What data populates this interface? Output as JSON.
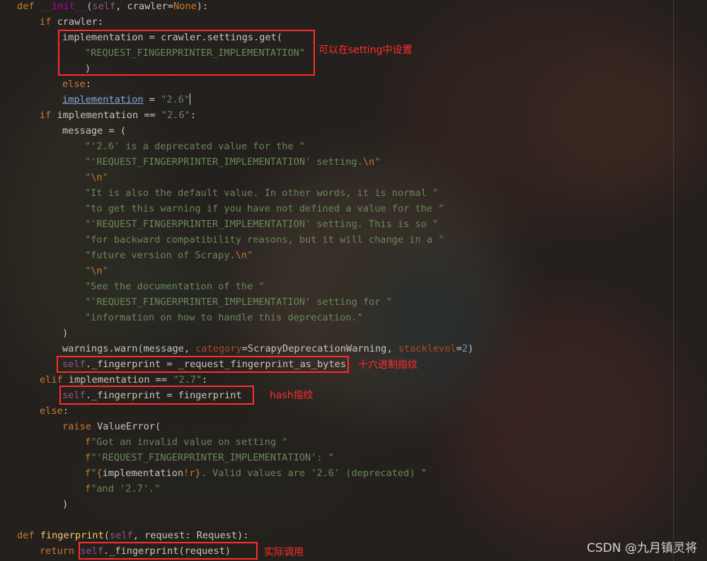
{
  "editor": {
    "lines": [
      [
        [
          "kw",
          "def "
        ],
        [
          "dnd",
          "__init__"
        ],
        [
          "t",
          "("
        ],
        [
          "slf",
          "self"
        ],
        [
          "t",
          ", crawler="
        ],
        [
          "kw",
          "None"
        ],
        [
          "t",
          "):"
        ]
      ],
      [
        [
          "kw",
          "if "
        ],
        [
          "t",
          "crawler:"
        ]
      ],
      [
        [
          "t",
          "implementation = crawler.settings.get("
        ]
      ],
      [
        [
          "str",
          "\"REQUEST_FINGERPRINTER_IMPLEMENTATION\""
        ]
      ],
      [
        [
          "t",
          ")"
        ]
      ],
      [
        [
          "kw",
          "else"
        ],
        [
          "t",
          ":"
        ]
      ],
      [
        [
          "udl",
          "implementation"
        ],
        [
          "t",
          " = "
        ],
        [
          "str",
          "\"2.6\""
        ],
        [
          "cursor",
          ""
        ]
      ],
      [
        [
          "kw",
          "if "
        ],
        [
          "t",
          "implementation == "
        ],
        [
          "str",
          "\"2.6\""
        ],
        [
          "t",
          ":"
        ]
      ],
      [
        [
          "t",
          "message = ("
        ]
      ],
      [
        [
          "str",
          "\"'2.6' is a deprecated value for the \""
        ]
      ],
      [
        [
          "str",
          "\"'REQUEST_FINGERPRINTER_IMPLEMENTATION' setting."
        ],
        [
          "esc",
          "\\n"
        ],
        [
          "str",
          "\""
        ]
      ],
      [
        [
          "str",
          "\""
        ],
        [
          "esc",
          "\\n"
        ],
        [
          "str",
          "\""
        ]
      ],
      [
        [
          "str",
          "\"It is also the default value. In other words, it is normal \""
        ]
      ],
      [
        [
          "str",
          "\"to get this warning if you have not defined a value for the \""
        ]
      ],
      [
        [
          "str",
          "\"'REQUEST_FINGERPRINTER_IMPLEMENTATION' setting. This is so \""
        ]
      ],
      [
        [
          "str",
          "\"for backward compatibility reasons, but it will change in a \""
        ]
      ],
      [
        [
          "str",
          "\"future version of Scrapy."
        ],
        [
          "esc",
          "\\n"
        ],
        [
          "str",
          "\""
        ]
      ],
      [
        [
          "str",
          "\""
        ],
        [
          "esc",
          "\\n"
        ],
        [
          "str",
          "\""
        ]
      ],
      [
        [
          "str",
          "\"See the documentation of the \""
        ]
      ],
      [
        [
          "str",
          "\"'REQUEST_FINGERPRINTER_IMPLEMENTATION' setting for \""
        ]
      ],
      [
        [
          "str",
          "\"information on how to handle this deprecation.\""
        ]
      ],
      [
        [
          "t",
          ")"
        ]
      ],
      [
        [
          "t",
          "warnings.warn(message, "
        ],
        [
          "prm",
          "category"
        ],
        [
          "t",
          "=ScrapyDeprecationWarning, "
        ],
        [
          "prm",
          "stacklevel"
        ],
        [
          "t",
          "="
        ],
        [
          "num",
          "2"
        ],
        [
          "t",
          ")"
        ]
      ],
      [
        [
          "slf",
          "self"
        ],
        [
          "t",
          "._fingerprint = _request_fingerprint_as_bytes"
        ]
      ],
      [
        [
          "kw",
          "elif "
        ],
        [
          "t",
          "implementation == "
        ],
        [
          "str",
          "\"2.7\""
        ],
        [
          "t",
          ":"
        ]
      ],
      [
        [
          "slf",
          "self"
        ],
        [
          "t",
          "._fingerprint = fingerprint"
        ]
      ],
      [
        [
          "kw",
          "else"
        ],
        [
          "t",
          ":"
        ]
      ],
      [
        [
          "kw",
          "raise "
        ],
        [
          "t",
          "ValueError("
        ]
      ],
      [
        [
          "kw",
          "f"
        ],
        [
          "str",
          "\"Got an invalid value on setting \""
        ]
      ],
      [
        [
          "kw",
          "f"
        ],
        [
          "str",
          "\"'REQUEST_FINGERPRINTER_IMPLEMENTATION': \""
        ]
      ],
      [
        [
          "kw",
          "f"
        ],
        [
          "str",
          "\""
        ],
        [
          "esc",
          "{"
        ],
        [
          "t",
          "implementation"
        ],
        [
          "esc",
          "!r}"
        ],
        [
          "str",
          ". Valid values are '2.6' (deprecated) \""
        ]
      ],
      [
        [
          "kw",
          "f"
        ],
        [
          "str",
          "\"and '2.7'.\""
        ]
      ],
      [
        [
          "t",
          ")"
        ]
      ],
      [
        [
          "t",
          ""
        ]
      ],
      [
        [
          "kw",
          "def "
        ],
        [
          "fn",
          "fingerprint"
        ],
        [
          "t",
          "("
        ],
        [
          "slf",
          "self"
        ],
        [
          "t",
          ", request: Request):"
        ]
      ],
      [
        [
          "kw",
          "return "
        ],
        [
          "slf",
          "self"
        ],
        [
          "t",
          "._fingerprint(request)"
        ]
      ]
    ]
  },
  "annotations": {
    "setting_note": "可以在setting中设置",
    "hex_note": "十六进制指纹",
    "hash_note": "hash指纹",
    "call_note": "实际调用"
  },
  "watermark": "CSDN @九月镇灵将"
}
